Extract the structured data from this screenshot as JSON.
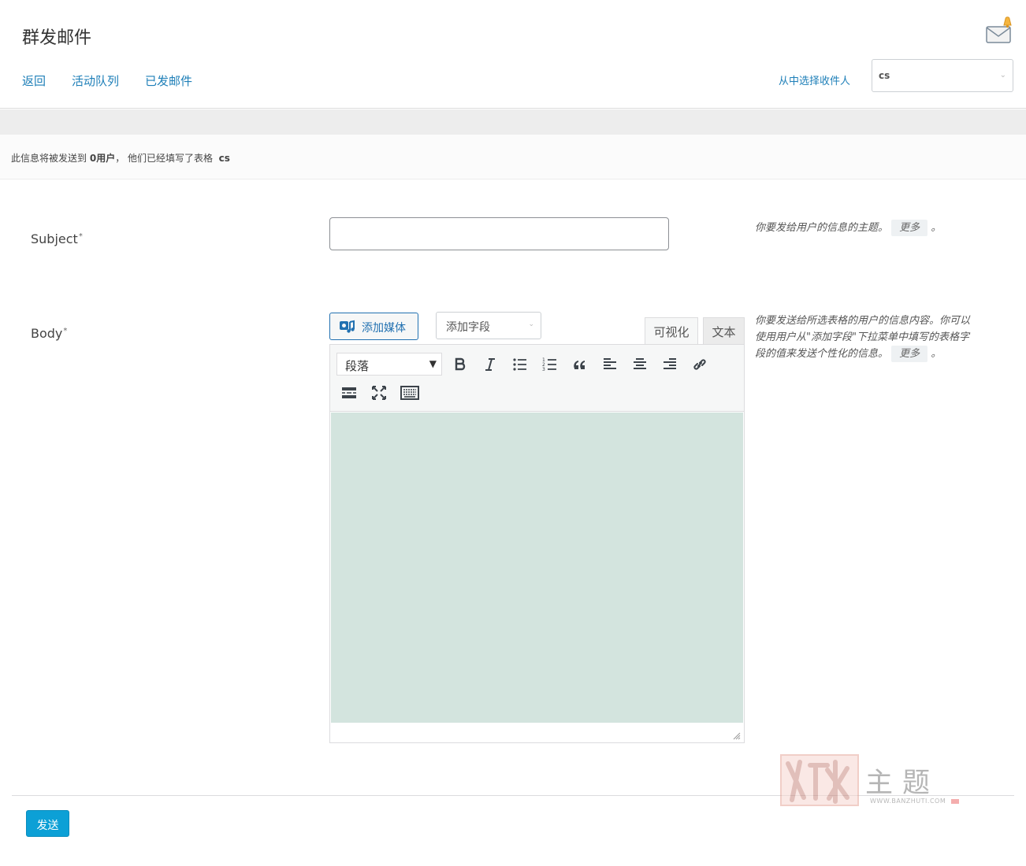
{
  "header": {
    "title": "群发邮件",
    "nav": [
      "返回",
      "活动队列",
      "已发邮件"
    ],
    "recipient_label": "从中选择收件人",
    "recipient_value": "cs"
  },
  "notice": {
    "prefix": "此信息将被发送到",
    "count": "0用户",
    "middle": "， 他们已经填写了表格",
    "form_name": "cs"
  },
  "form": {
    "subject_label": "Subject",
    "required_mark": "*",
    "subject_value": "",
    "subject_help": "你要发给用户的信息的主题。",
    "more_label": "更多",
    "help_end": "。",
    "body_label": "Body",
    "body_help_1": "你要发送给所选表格的用户的信息内容。你可以",
    "body_help_2": "使用用户从\"添加字段\"下拉菜单中填写的表格字",
    "body_help_3": "段的值来发送个性化的信息。"
  },
  "editor": {
    "add_media": "添加媒体",
    "add_field": "添加字段",
    "tab_visual": "可视化",
    "tab_text": "文本",
    "format_value": "段落",
    "toolbar_icons": [
      "bold-icon",
      "italic-icon",
      "bullet-list-icon",
      "numbered-list-icon",
      "blockquote-icon",
      "align-left-icon",
      "align-center-icon",
      "align-right-icon",
      "link-icon",
      "read-more-icon",
      "fullscreen-icon",
      "toolbar-toggle-icon"
    ],
    "content_color": "#d3e4de"
  },
  "actions": {
    "send_label": "发送"
  },
  "watermark": {
    "text": "主题",
    "url": "WWW.BANZHUTI.COM"
  },
  "colors": {
    "link": "#1e7fb8",
    "primary_button": "#0ca0d6"
  }
}
